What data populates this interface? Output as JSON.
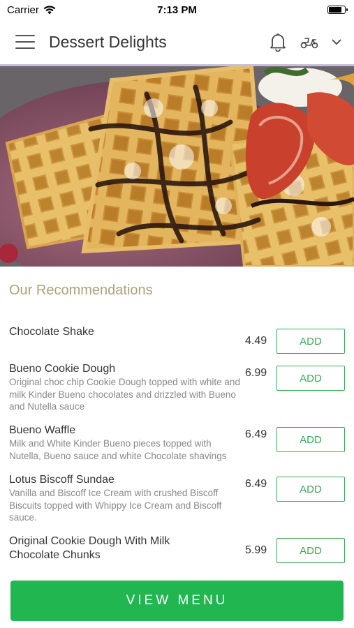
{
  "status": {
    "carrier": "Carrier",
    "time": "7:13 PM",
    "battery_level": 0.85
  },
  "header": {
    "title": "Dessert Delights"
  },
  "section": {
    "title": "Our Recommendations"
  },
  "items": [
    {
      "name": "Chocolate Shake",
      "description": "",
      "price": "4.49",
      "button": "ADD"
    },
    {
      "name": "Bueno Cookie Dough",
      "description": "Original choc chip Cookie Dough topped with white and milk Kinder Bueno chocolates and drizzled with Bueno and Nutella sauce",
      "price": "6.99",
      "button": "ADD"
    },
    {
      "name": "Bueno Waffle",
      "description": "Milk and White Kinder Bueno pieces topped with Nutella, Bueno sauce and white Chocolate shavings",
      "price": "6.49",
      "button": "ADD"
    },
    {
      "name": "Lotus Biscoff Sundae",
      "description": "Vanilla and Biscoff Ice Cream with crushed Biscoff Biscuits topped with Whippy Ice Cream and Biscoff sauce.",
      "price": "6.49",
      "button": "ADD"
    },
    {
      "name": "Original Cookie Dough With Milk Chocolate Chunks",
      "description": "",
      "price": "5.99",
      "button": "ADD"
    }
  ],
  "footer": {
    "view_menu_label": "VIEW MENU"
  },
  "colors": {
    "accent": "#22b650",
    "section_title": "#b0a07a",
    "add_border": "#3aa857"
  },
  "icons": [
    "hamburger-menu-icon",
    "bell-icon",
    "scooter-icon",
    "chevron-down-icon",
    "wifi-icon",
    "battery-icon"
  ]
}
